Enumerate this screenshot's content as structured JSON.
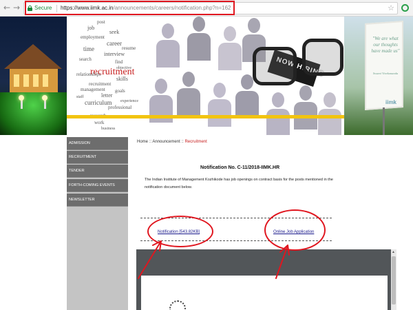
{
  "browser": {
    "secure_label": "Secure",
    "url_host": "https://www.iimk.ac.in",
    "url_path": "/announcements/careers/notification.php?n=162",
    "icons": {
      "back": "back-arrow-icon",
      "forward": "forward-arrow-icon",
      "lock": "lock-icon",
      "bookmark": "star-icon",
      "extension": "extension-icon"
    },
    "colors": {
      "secure": "#1b8a3c",
      "annotation": "#e0161f"
    }
  },
  "banner": {
    "wordcloud_words": [
      "post",
      "job",
      "seek",
      "employment",
      "career",
      "time",
      "interview",
      "search",
      "find",
      "recruitment",
      "management",
      "letter",
      "curriculum",
      "professional",
      "research",
      "work",
      "skills",
      "goals",
      "relationships",
      "resume",
      "objective",
      "staff",
      "experience",
      "business"
    ],
    "highlight_word": "recruitment",
    "now_hiring": "NOW HIRING",
    "board_quote": "\"We are what our thoughts have made us\"",
    "board_attribution": "Swami Vivekananda",
    "board_logo": "iimk"
  },
  "sidebar": {
    "items": [
      {
        "label": "ADMISSION"
      },
      {
        "label": "RECRUITMENT"
      },
      {
        "label": "TENDER"
      },
      {
        "label": "FORTH-COMING EVENTS"
      },
      {
        "label": "NEWSLETTER"
      }
    ]
  },
  "content": {
    "breadcrumb": {
      "home": "Home",
      "section": "Announcement",
      "current": "Recruitment",
      "separator": "::"
    },
    "title": "Notification No. C-11/2018-IIMK.HR",
    "body": "The Indian Institute of Management Kozhikode has job openings on contract basis for the posts mentioned in the notification document below.",
    "notification_link": "Notification [543.82KB]",
    "apply_link": "Online Job Application"
  }
}
